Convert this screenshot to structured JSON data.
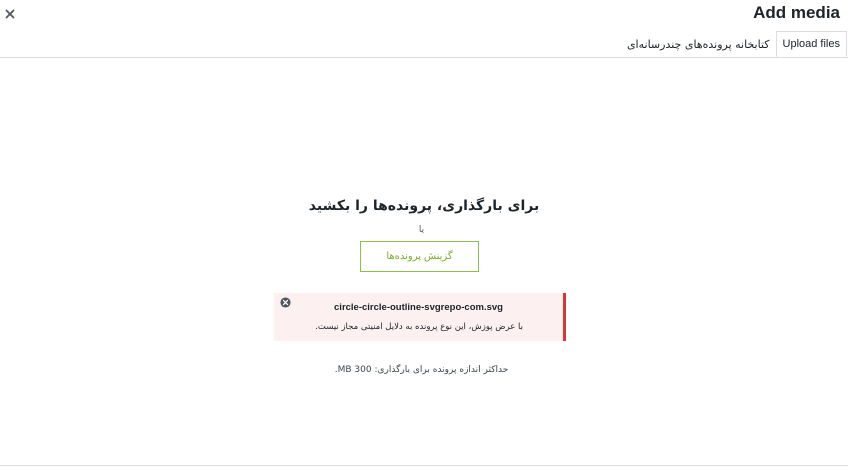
{
  "header": {
    "title": "Add media",
    "close_icon": "close-icon"
  },
  "tabs": [
    {
      "label": "Upload files",
      "active": true
    },
    {
      "label": "کتابخانه پرونده‌های چندرسانه‌ای",
      "active": false
    }
  ],
  "uploader": {
    "drop_instructions": "برای بارگذاری، پرونده‌ها را بکشید",
    "or_text": "یا",
    "select_button_label": "گزینش پرونده‌ها",
    "max_size_text": "حداکثر اندازه پرونده برای بارگذاری: 300 MB."
  },
  "error": {
    "filename": "circle-circle-outline-svgrepo-com.svg",
    "message": "با عرض پوزش، این نوع پرونده به دلایل امنیتی مجاز نیست.",
    "dismiss_icon": "dismiss-circle-icon",
    "accent_color": "#d63638",
    "background_color": "#fcf0f1"
  },
  "colors": {
    "button_border": "#8fbf4a",
    "button_text": "#7cad32",
    "divider": "#dcdcde"
  }
}
